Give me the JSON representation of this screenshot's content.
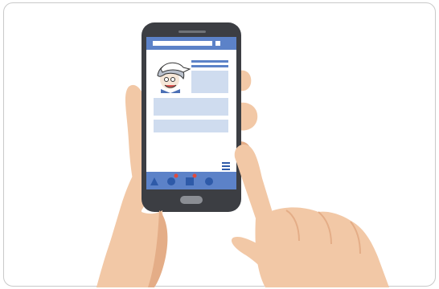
{
  "colors": {
    "frame_border": "#c9c9c9",
    "skin": "#f2c8a6",
    "skin_shadow": "#e4ad87",
    "phone_body": "#3c3e43",
    "phone_edge": "#2f3134",
    "screen_bg": "#ffffff",
    "header_bar": "#5c82c8",
    "content_block": "#cfdcef",
    "text_line": "#5c82c8",
    "nav_bar": "#5c82c8",
    "nav_icon": "#2e5aa8",
    "badge": "#e24a3b",
    "home_button": "#8b8e94"
  },
  "phone": {
    "header": {
      "search_field": "",
      "icon": "square-icon"
    },
    "profile": {
      "avatar": "cartoon-character-avatar"
    },
    "menu_icon": "hamburger-icon",
    "nav": [
      {
        "icon": "triangle-icon",
        "badge": false
      },
      {
        "icon": "circle-icon",
        "badge": true
      },
      {
        "icon": "square-icon",
        "badge": true
      },
      {
        "icon": "circle-icon",
        "badge": false
      }
    ]
  }
}
